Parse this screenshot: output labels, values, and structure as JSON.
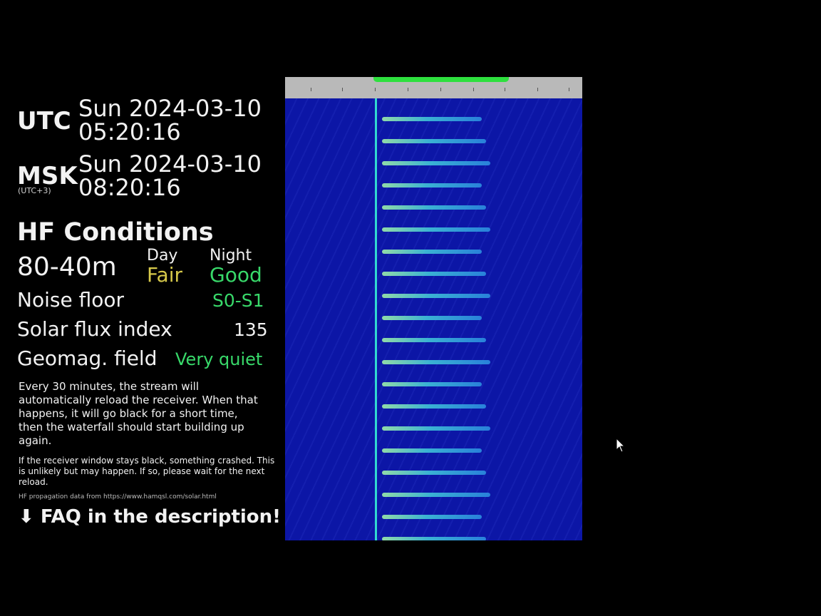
{
  "clocks": {
    "utc": {
      "zone": "UTC",
      "date": "Sun 2024-03-10",
      "time": "05:20:16"
    },
    "msk": {
      "zone": "MSK",
      "offset": "(UTC+3)",
      "date": "Sun 2024-03-10",
      "time": "08:20:16"
    }
  },
  "hf": {
    "title": "HF Conditions",
    "band": "80-40m",
    "day_label": "Day",
    "night_label": "Night",
    "day_value": "Fair",
    "night_value": "Good",
    "noise_label": "Noise floor",
    "noise_value": "S0-S1",
    "sfi_label": "Solar flux index",
    "sfi_value": "135",
    "geomag_label": "Geomag. field",
    "geomag_value": "Very quiet"
  },
  "notes": {
    "reload": "Every 30 minutes, the stream will automatically reload the receiver. When that happens, it will go black for a short time, then the waterfall should start building up again.",
    "crash": "If the receiver window stays black, something crashed. This is unlikely but may happen. If so, please wait for the next reload.",
    "source": "HF propagation data from https://www.hamqsl.com/solar.html",
    "faq": "⬇ FAQ in the description! ⬇"
  },
  "colors": {
    "fair": "#d6c94a",
    "good": "#38d96a",
    "waterfall": "#0c16a6",
    "passband": "#2ee03e"
  },
  "icons": {
    "cursor": "mouse-pointer-icon"
  }
}
